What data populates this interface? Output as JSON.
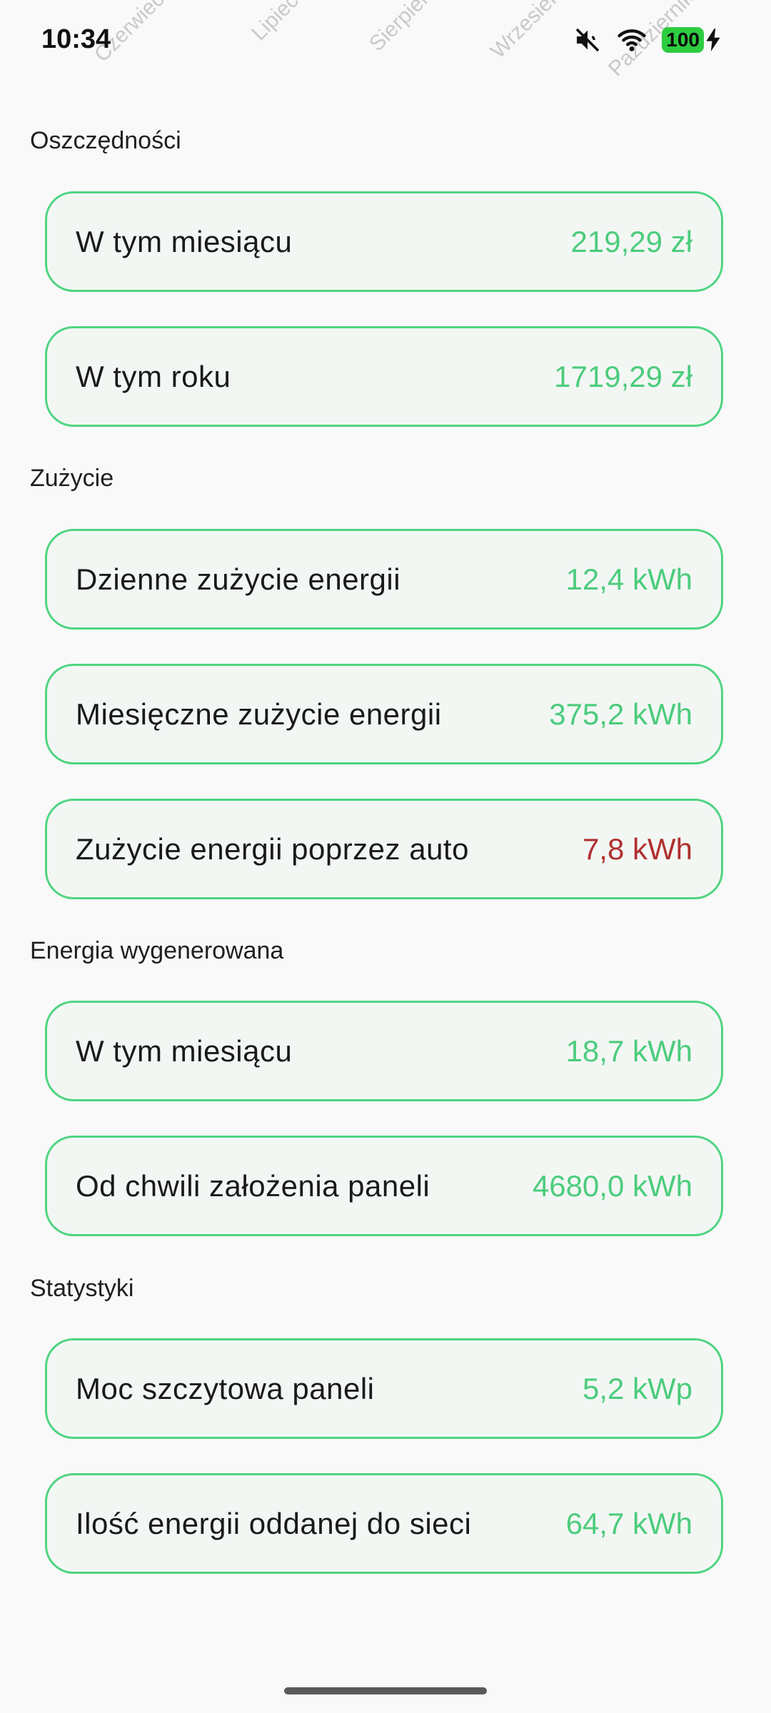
{
  "status_bar": {
    "time": "10:34",
    "battery": "100",
    "ghost_months": [
      "Czerwiec",
      "Lipiec",
      "Sierpień",
      "Wrzesień",
      "Październik"
    ]
  },
  "colors": {
    "accent": "#4fd481",
    "value_green": "#4ccc7c",
    "value_red": "#b03030",
    "background": "#f8f9f8"
  },
  "sections": [
    {
      "title": "Oszczędności",
      "items": [
        {
          "label": "W tym miesiącu",
          "value": "219,29 zł"
        },
        {
          "label": "W tym roku",
          "value": "1719,29 zł"
        }
      ]
    },
    {
      "title": "Zużycie",
      "items": [
        {
          "label": "Dzienne zużycie energii",
          "value": "12,4 kWh"
        },
        {
          "label": "Miesięczne zużycie energii",
          "value": "375,2 kWh"
        },
        {
          "label": "Zużycie energii poprzez auto",
          "value": "7,8 kWh"
        }
      ]
    },
    {
      "title": "Energia wygenerowana",
      "items": [
        {
          "label": "W tym miesiącu",
          "value": "18,7 kWh"
        },
        {
          "label": "Od chwili założenia paneli",
          "value": "4680,0 kWh"
        }
      ]
    },
    {
      "title": "Statystyki",
      "items": [
        {
          "label": "Moc szczytowa paneli",
          "value": "5,2 kWp"
        },
        {
          "label": "Ilość energii oddanej do sieci",
          "value": "64,7 kWh"
        }
      ]
    }
  ]
}
